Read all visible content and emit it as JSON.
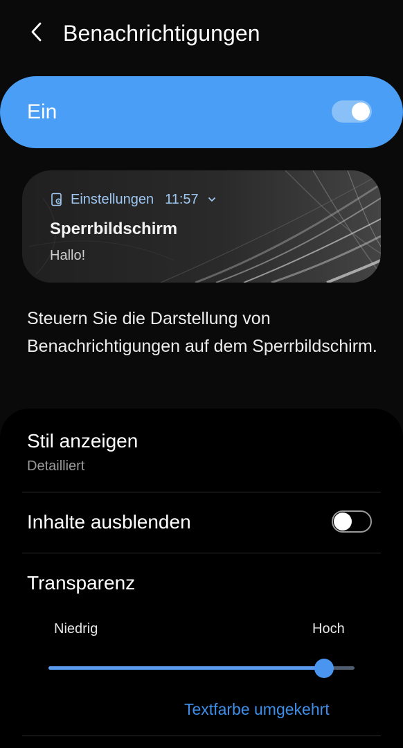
{
  "header": {
    "title": "Benachrichtigungen"
  },
  "master": {
    "label": "Ein",
    "enabled": true
  },
  "preview": {
    "app_name": "Einstellungen",
    "time": "11:57",
    "title": "Sperrbildschirm",
    "body": "Hallo!"
  },
  "description": "Steuern Sie die Darstellung von Benachrichtigungen auf dem Sperrbildschirm.",
  "settings": {
    "style": {
      "title": "Stil anzeigen",
      "value": "Detailliert"
    },
    "hide_content": {
      "title": "Inhalte ausblenden",
      "enabled": false
    },
    "transparency": {
      "title": "Transparenz",
      "min_label": "Niedrig",
      "max_label": "Hoch",
      "level": 0.9
    },
    "invert_text_color": {
      "label": "Textfarbe umgekehrt"
    }
  },
  "colors": {
    "accent": "#4a9ef5",
    "background": "#0a0a0a",
    "link": "#3f8fe8"
  },
  "icons": [
    "back-arrow-icon",
    "settings-app-icon",
    "chevron-down-icon"
  ]
}
